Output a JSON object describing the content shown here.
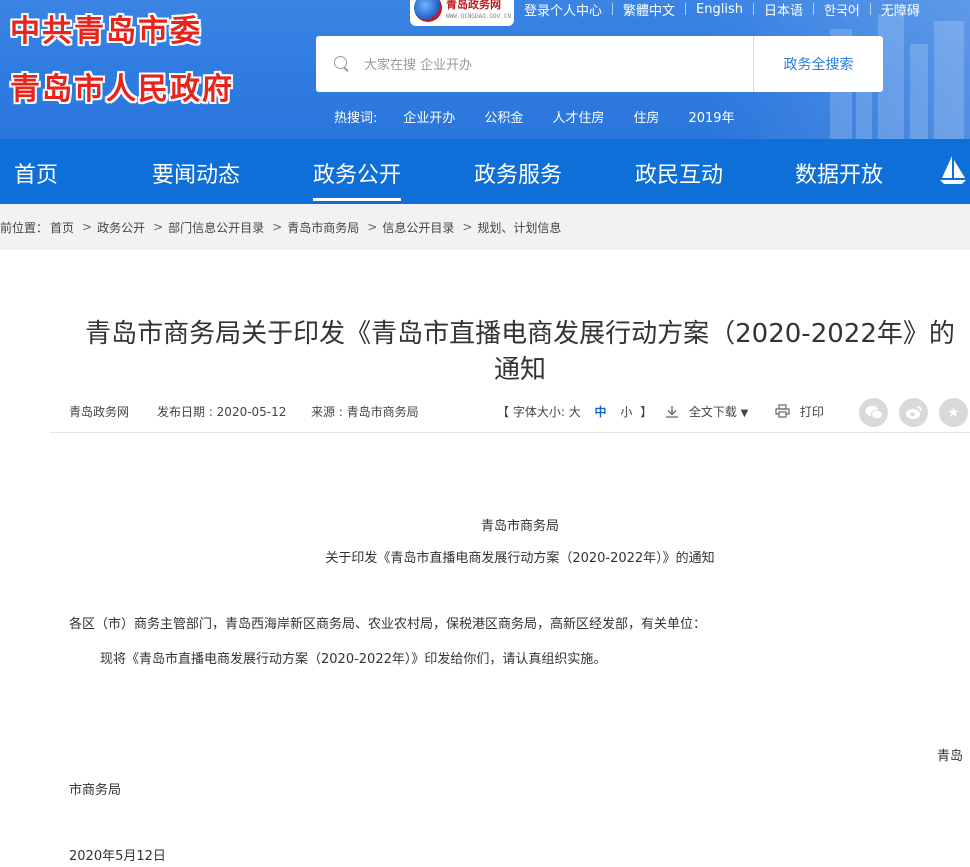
{
  "header": {
    "org_name_1": "中共青岛市委",
    "org_name_2": "青岛市人民政府",
    "portal_badge": {
      "name": "青岛政务网",
      "domain": "WWW.QINGDAO.GOV.CN"
    },
    "top_links": [
      "登录个人中心",
      "繁體中文",
      "English",
      "日本语",
      "한국어",
      "无障碍"
    ],
    "search": {
      "placeholder": "大家在搜 企业开办",
      "button": "政务全搜索"
    },
    "hot_label": "热搜词:",
    "hot_words": [
      "企业开办",
      "公积金",
      "人才住房",
      "住房",
      "2019年"
    ]
  },
  "nav": {
    "items": [
      "首页",
      "要闻动态",
      "政务公开",
      "政务服务",
      "政民互动",
      "数据开放"
    ],
    "active_index": 2
  },
  "breadcrumb": [
    "前位置：",
    "首页",
    "政务公开",
    "部门信息公开目录",
    "青岛市商务局",
    "信息公开目录",
    "规划、计划信息"
  ],
  "article": {
    "title_line1": "青岛市商务局关于印发《青岛市直播电商发展行动方案（2020-2022年》的",
    "title_line2": "通知",
    "meta": {
      "site": "青岛政务网",
      "date": "发布日期 : 2020-05-12",
      "source": "来源 : 青岛市商务局",
      "font_size_label": "【 字体大小:",
      "font_large": "大",
      "font_medium": "中",
      "font_small": "小",
      "font_close": "】",
      "download": "全文下载",
      "print": "打印"
    },
    "issuer": "青岛市商务局",
    "subtitle": "关于印发《青岛市直播电商发展行动方案（2020-2022年）》的通知",
    "recipients": "各区（市）商务主管部门，青岛西海岸新区商务局、农业农村局，保税港区商务局，高新区经发部，有关单位：",
    "body": "现将《青岛市直播电商发展行动方案（2020-2022年）》印发给你们，请认真组织实施。",
    "sign_right": "青岛",
    "sign_left": "市商务局",
    "sign_date": "2020年5月12日"
  },
  "colors": {
    "header_blue": "#2f7be0",
    "nav_blue": "#0f6fd8",
    "logo_red": "#e8231b"
  }
}
